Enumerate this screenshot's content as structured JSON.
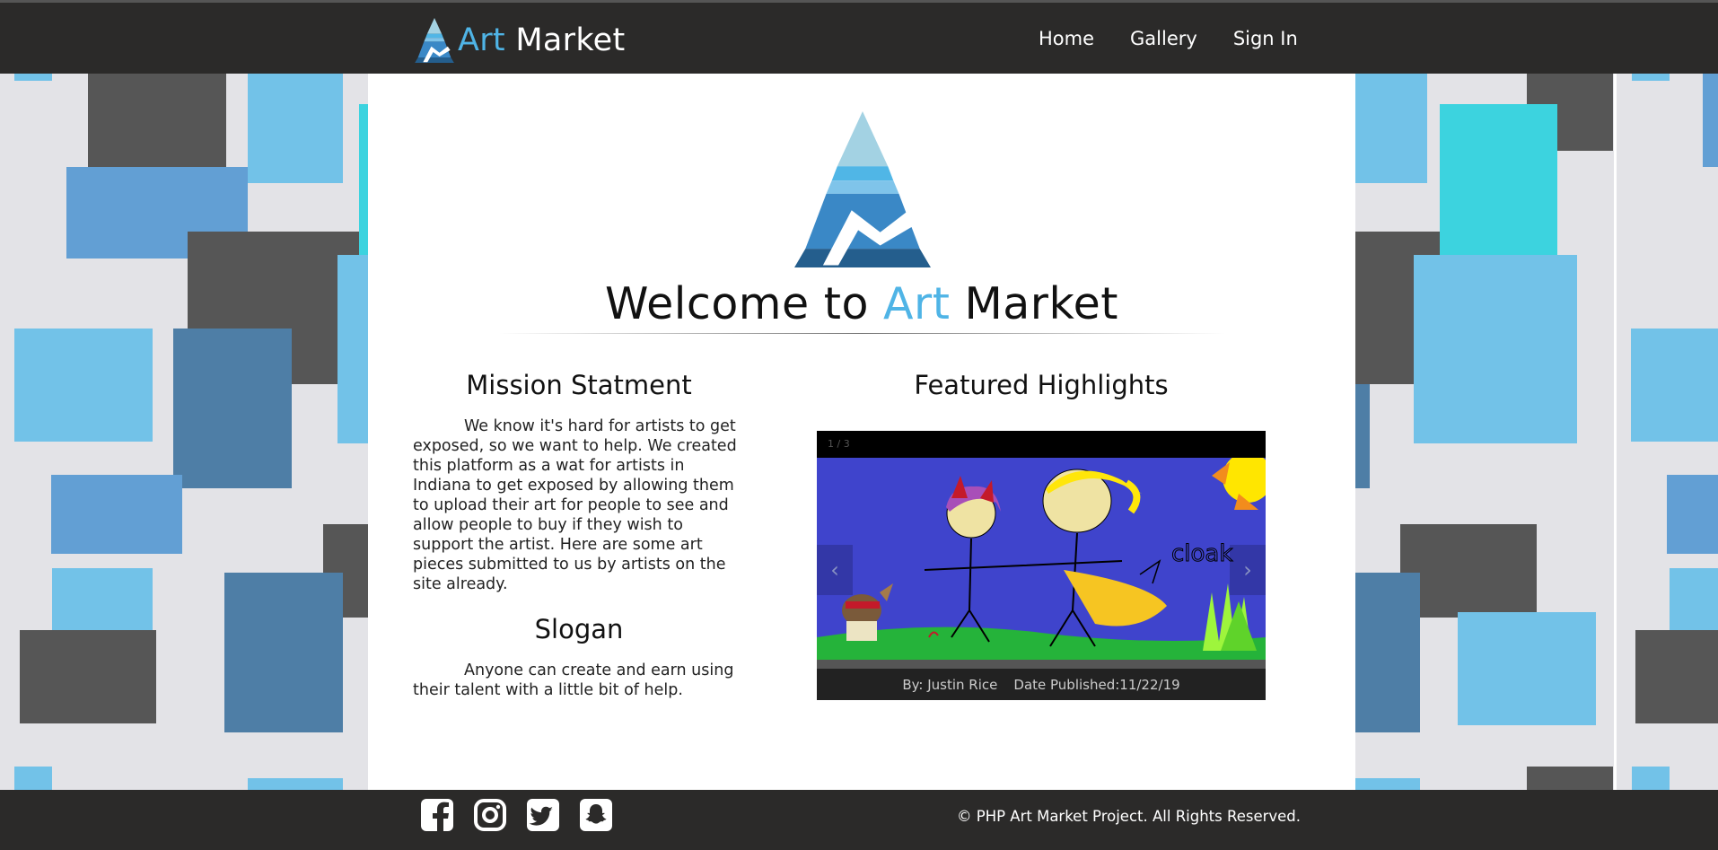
{
  "colors": {
    "accent": "#4fb4e6",
    "navbar": "#2b2a29",
    "footer": "#2b2a29"
  },
  "navbar": {
    "brand_accent": "Art",
    "brand_rest": " Market",
    "links": [
      {
        "label": "Home"
      },
      {
        "label": "Gallery"
      },
      {
        "label": "Sign In"
      }
    ]
  },
  "main": {
    "welcome_prefix": "Welcome to ",
    "welcome_accent": "Art",
    "welcome_suffix": " Market",
    "mission": {
      "title": "Mission Statment",
      "text": "We know it's hard for artists to get exposed, so we want to help. We created this platform as a wat for artists in Indiana to get exposed by allowing them to upload their art for people to see and allow people to buy if they wish to support the artist. Here are some art pieces submitted to us by artists on the site already."
    },
    "slogan": {
      "title": "Slogan",
      "text": "Anyone can create and earn using their talent with a little bit of help."
    },
    "featured": {
      "title": "Featured Highlights",
      "counter": "1 / 3",
      "artwork_text": "cloak",
      "author": "By: Justin Rice",
      "date": "Date Published:11/22/19",
      "prev_icon": "chevron-left-icon",
      "next_icon": "chevron-right-icon"
    }
  },
  "footer": {
    "social": [
      "facebook-icon",
      "instagram-icon",
      "twitter-icon",
      "snapchat-icon"
    ],
    "copyright": "© PHP Art Market Project. All Rights Reserved."
  }
}
